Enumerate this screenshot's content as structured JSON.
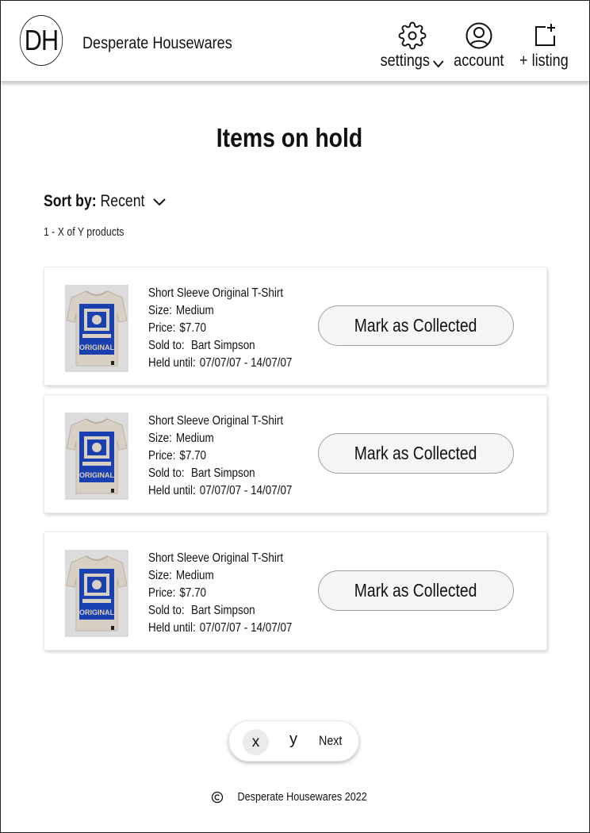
{
  "header": {
    "logo_text": "DH",
    "brand_name": "Desperate Housewares",
    "nav": {
      "settings_label": "settings",
      "account_label": "account",
      "listing_label": "+ listing"
    }
  },
  "main": {
    "title": "Items on hold",
    "sort_label": "Sort by:",
    "sort_value": "Recent",
    "result_count": "1 - X of Y products",
    "items": [
      {
        "name": "Short Sleeve Original T-Shirt",
        "size_label": "Size:",
        "size": "Medium",
        "price_label": "Price:",
        "price": "$7.70",
        "sold_label": "Sold to:",
        "sold_to": "Bart Simpson",
        "held_label": "Held until:",
        "held_until": "07/07/07 - 14/07/07",
        "image_text": "ORIGINAL",
        "button_label": "Mark as Collected"
      },
      {
        "name": "Short Sleeve Original T-Shirt",
        "size_label": "Size:",
        "size": "Medium",
        "price_label": "Price:",
        "price": "$7.70",
        "sold_label": "Sold to:",
        "sold_to": "Bart Simpson",
        "held_label": "Held until:",
        "held_until": "07/07/07 - 14/07/07",
        "image_text": "ORIGINAL",
        "button_label": "Mark as Collected"
      },
      {
        "name": "Short Sleeve Original T-Shirt",
        "size_label": "Size:",
        "size": "Medium",
        "price_label": "Price:",
        "price": "$7.70",
        "sold_label": "Sold to:",
        "sold_to": "Bart Simpson",
        "held_label": "Held until:",
        "held_until": "07/07/07 - 14/07/07",
        "image_text": "ORIGINAL",
        "button_label": "Mark as Collected"
      }
    ]
  },
  "pagination": {
    "current": "x",
    "other": "y",
    "next_label": "Next"
  },
  "footer": {
    "copyright_symbol": "©",
    "text": "Desperate Housewares 2022"
  },
  "colors": {
    "shirt": "#d8d0c4",
    "print": "#1a3fae",
    "button_bg": "#f5f5f5"
  }
}
